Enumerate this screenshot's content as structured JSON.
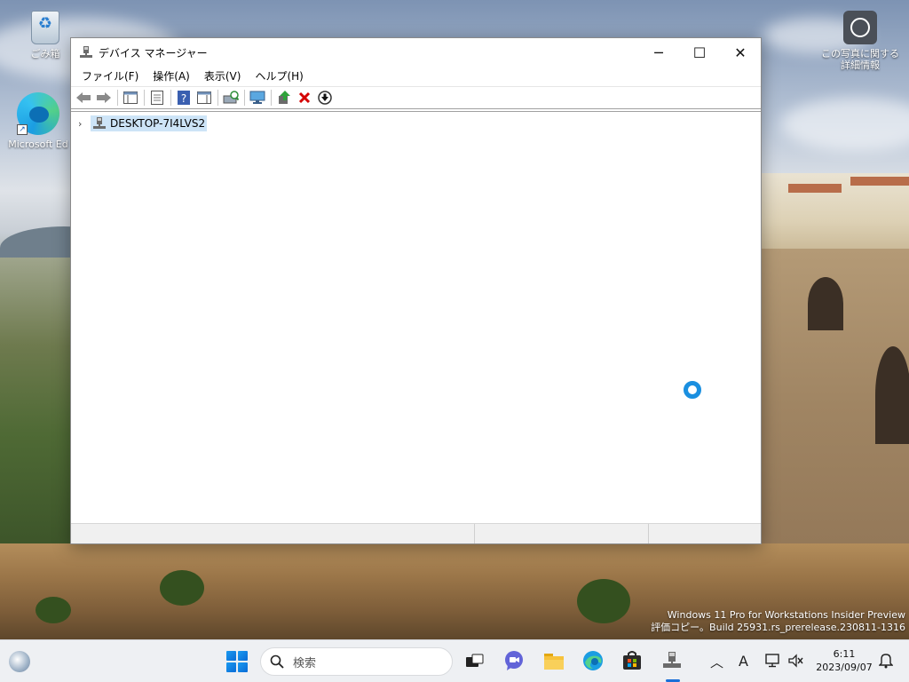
{
  "desktop": {
    "icons": [
      {
        "label": "ごみ箱",
        "icon": "recycle-bin-icon"
      },
      {
        "label": "Microsoft Ed",
        "icon": "edge-icon"
      },
      {
        "label": "この写真に関する詳細情報",
        "icon": "camera-icon"
      }
    ],
    "watermark": {
      "line1": "Windows 11 Pro for Workstations Insider Preview",
      "line2": "評価コピー。Build 25931.rs_prerelease.230811-1316"
    }
  },
  "window": {
    "title": "デバイス マネージャー",
    "app_icon": "device-manager-icon",
    "controls": {
      "minimize": "─",
      "maximize": "☐",
      "close": "✕"
    },
    "menu": [
      "ファイル(F)",
      "操作(A)",
      "表示(V)",
      "ヘルプ(H)"
    ],
    "toolbar": [
      {
        "name": "back",
        "icon": "arrow-left-icon"
      },
      {
        "name": "forward",
        "icon": "arrow-right-icon"
      },
      {
        "name": "show-hide-console-tree",
        "icon": "console-tree-icon"
      },
      {
        "name": "properties",
        "icon": "properties-icon"
      },
      {
        "name": "help",
        "icon": "help-icon"
      },
      {
        "name": "action-pane",
        "icon": "action-pane-icon"
      },
      {
        "name": "scan-hardware",
        "icon": "scan-hardware-icon"
      },
      {
        "name": "monitor",
        "icon": "monitor-icon"
      },
      {
        "name": "update-driver",
        "icon": "update-driver-icon"
      },
      {
        "name": "uninstall-device",
        "icon": "uninstall-icon"
      },
      {
        "name": "disable-device",
        "icon": "disable-device-icon"
      }
    ],
    "tree": {
      "root_label": "DESKTOP-7I4LVS2",
      "expander": "›",
      "selected": true
    }
  },
  "taskbar": {
    "search_placeholder": "検索",
    "apps": [
      "task-view-icon",
      "teams-chat-icon",
      "file-explorer-icon",
      "edge-icon",
      "store-icon",
      "device-manager-icon"
    ],
    "active_app": "device-manager-icon",
    "tray": {
      "chevron": "︿",
      "ime": "A",
      "network": "network-icon",
      "volume": "muted-volume-icon"
    },
    "clock": {
      "time": "6:11",
      "date": "2023/09/07"
    },
    "notification": "notification-icon"
  },
  "colors": {
    "accent": "#1a6fd8",
    "selection": "#cde4f7",
    "busy_cursor": "#1a8fe0",
    "uninstall_red": "#d40000"
  }
}
